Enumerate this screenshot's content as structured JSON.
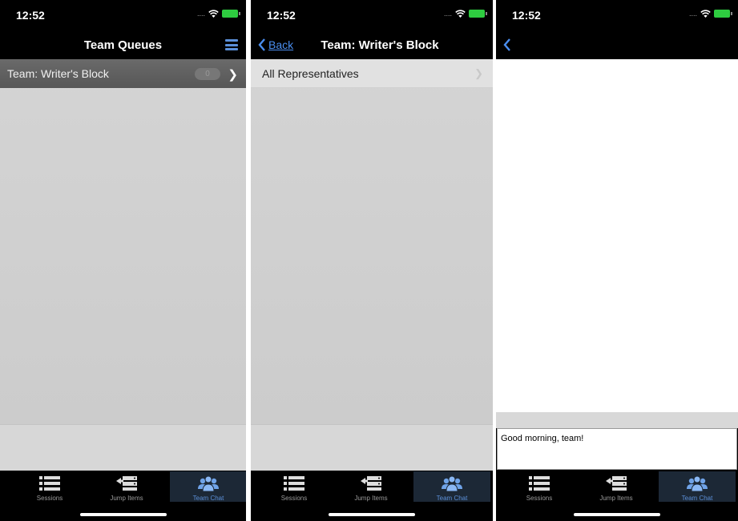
{
  "status": {
    "time": "12:52",
    "dots": "....",
    "icons": [
      "wifi-icon",
      "battery-charging-icon"
    ]
  },
  "screen1": {
    "nav_title": "Team Queues",
    "row_label": "Team: Writer's Block",
    "row_badge": "0"
  },
  "screen2": {
    "back_label": "Back",
    "nav_title": "Team: Writer's Block",
    "row_label": "All Representatives"
  },
  "screen3": {
    "message_text": "Good morning, team!"
  },
  "tabs": [
    {
      "label": "Sessions",
      "icon": "list-icon"
    },
    {
      "label": "Jump Items",
      "icon": "jump-server-icon"
    },
    {
      "label": "Team Chat",
      "icon": "team-icon"
    }
  ],
  "colors": {
    "accent": "#5b8fd8",
    "link": "#4a8ef0",
    "tab_active_bg": "#1c2836"
  }
}
